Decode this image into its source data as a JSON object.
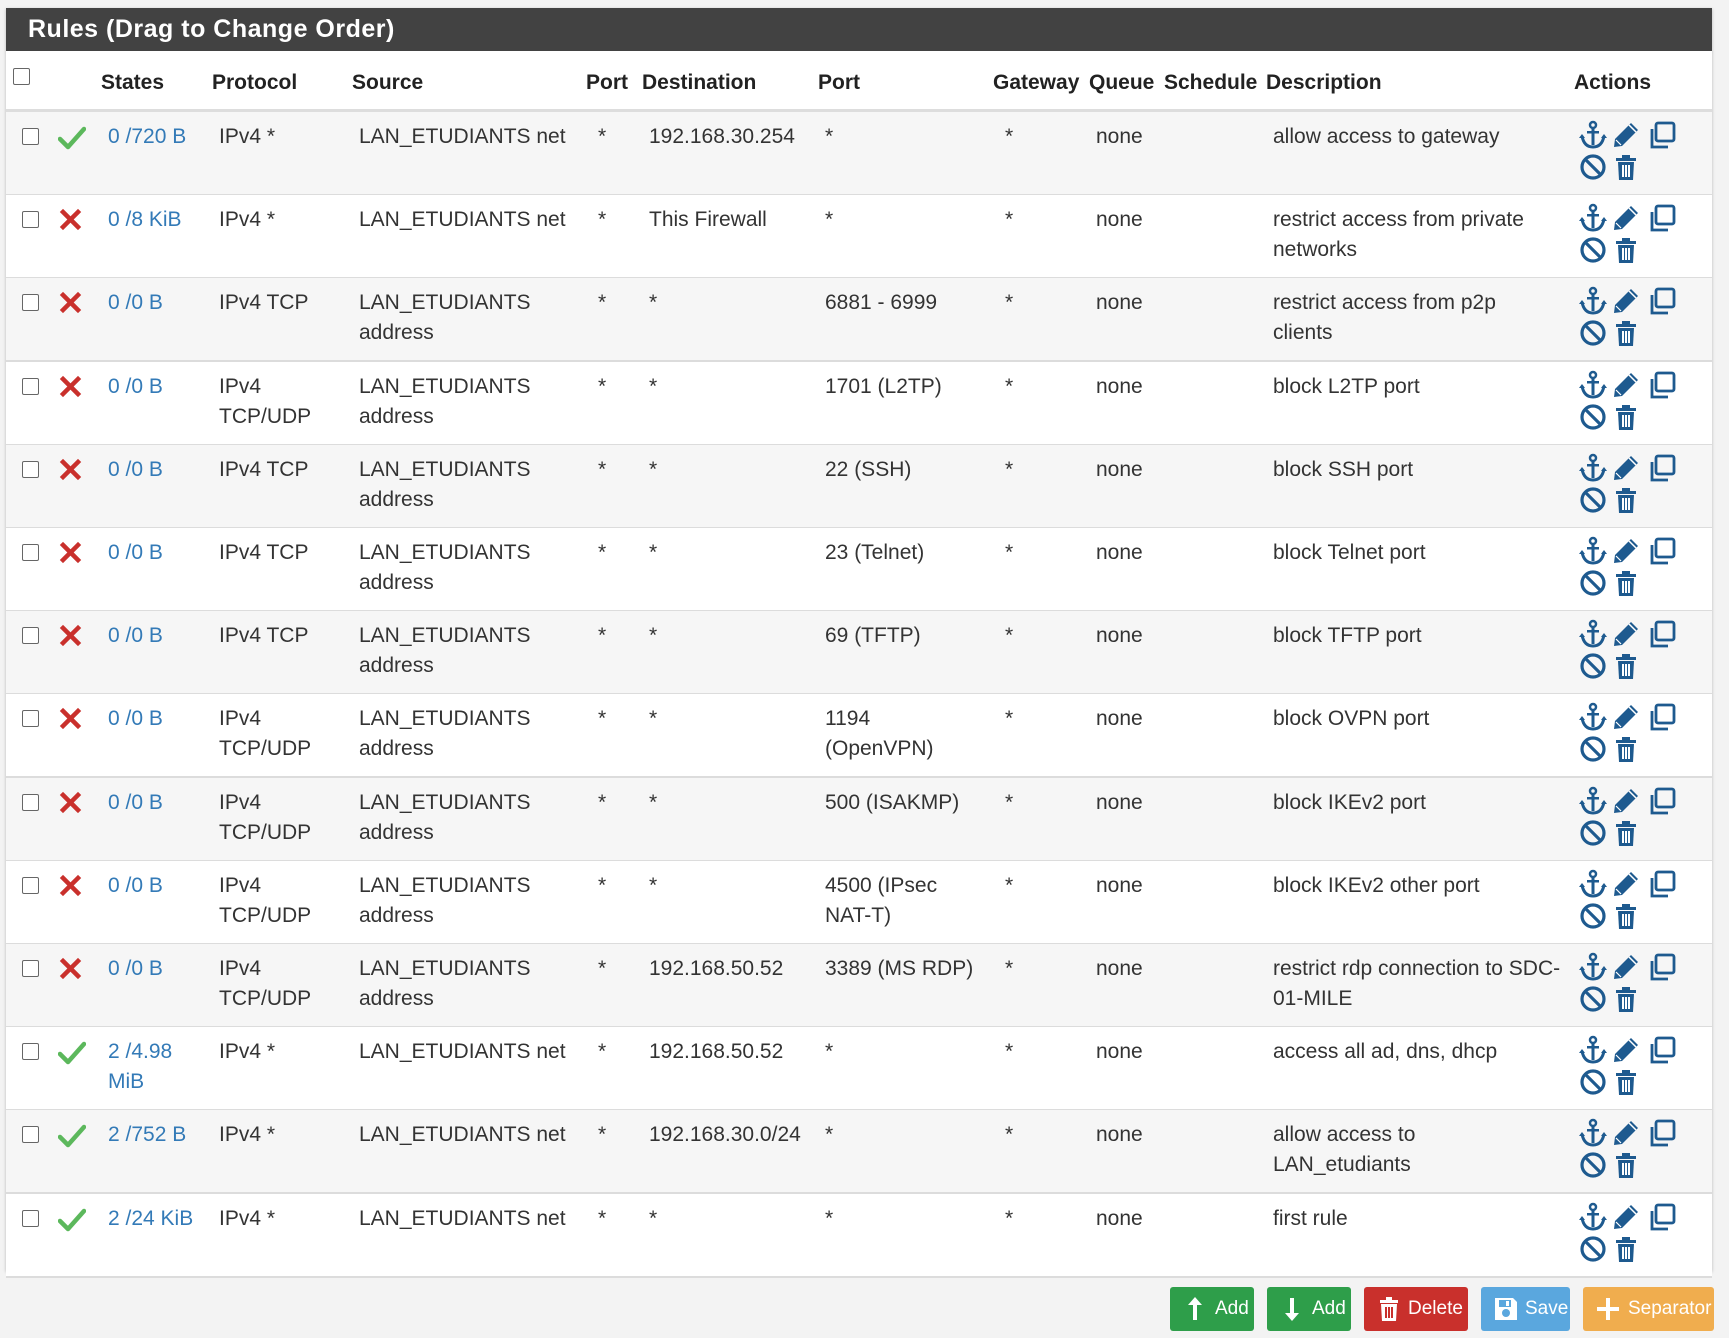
{
  "panel": {
    "title": "Rules (Drag to Change Order)"
  },
  "columns": {
    "states": "States",
    "protocol": "Protocol",
    "source": "Source",
    "port": "Port",
    "destination": "Destination",
    "dest_port": "Port",
    "gateway": "Gateway",
    "queue": "Queue",
    "schedule": "Schedule",
    "description": "Description",
    "actions": "Actions"
  },
  "colors": {
    "pass": "#5cb85c",
    "block": "#c9302c",
    "link": "#337ab7",
    "action_icon": "#1e5a8f",
    "header_bg": "#424242"
  },
  "rules": [
    {
      "status": "pass",
      "states1": "0 /720 B",
      "states2": "",
      "proto1": "IPv4 *",
      "proto2": "",
      "src1": "LAN_ETUDIANTS net",
      "src2": "",
      "sport": "*",
      "dest1": "192.168.30.254",
      "dport1": "*",
      "dport2": "",
      "gateway": "*",
      "queue": "none",
      "schedule": "",
      "desc1": "allow access to gateway",
      "desc2": ""
    },
    {
      "status": "block",
      "states1": "0 /8 KiB",
      "states2": "",
      "proto1": "IPv4 *",
      "proto2": "",
      "src1": "LAN_ETUDIANTS net",
      "src2": "",
      "sport": "*",
      "dest1": "This Firewall",
      "dport1": "*",
      "dport2": "",
      "gateway": "*",
      "queue": "none",
      "schedule": "",
      "desc1": "restrict access from private",
      "desc2": "networks"
    },
    {
      "status": "block",
      "states1": "0 /0 B",
      "states2": "",
      "proto1": "IPv4 TCP",
      "proto2": "",
      "src1": "LAN_ETUDIANTS",
      "src2": "address",
      "sport": "*",
      "dest1": "*",
      "dport1": "6881 - 6999",
      "dport2": "",
      "gateway": "*",
      "queue": "none",
      "schedule": "",
      "desc1": "restrict access from p2p",
      "desc2": "clients"
    },
    {
      "status": "block",
      "states1": "0 /0 B",
      "states2": "",
      "proto1": "IPv4",
      "proto2": "TCP/UDP",
      "src1": "LAN_ETUDIANTS",
      "src2": "address",
      "sport": "*",
      "dest1": "*",
      "dport1": "1701 (L2TP)",
      "dport2": "",
      "gateway": "*",
      "queue": "none",
      "schedule": "",
      "desc1": "block L2TP port",
      "desc2": ""
    },
    {
      "status": "block",
      "states1": "0 /0 B",
      "states2": "",
      "proto1": "IPv4 TCP",
      "proto2": "",
      "src1": "LAN_ETUDIANTS",
      "src2": "address",
      "sport": "*",
      "dest1": "*",
      "dport1": "22 (SSH)",
      "dport2": "",
      "gateway": "*",
      "queue": "none",
      "schedule": "",
      "desc1": "block SSH port",
      "desc2": ""
    },
    {
      "status": "block",
      "states1": "0 /0 B",
      "states2": "",
      "proto1": "IPv4 TCP",
      "proto2": "",
      "src1": "LAN_ETUDIANTS",
      "src2": "address",
      "sport": "*",
      "dest1": "*",
      "dport1": "23 (Telnet)",
      "dport2": "",
      "gateway": "*",
      "queue": "none",
      "schedule": "",
      "desc1": "block Telnet port",
      "desc2": ""
    },
    {
      "status": "block",
      "states1": "0 /0 B",
      "states2": "",
      "proto1": "IPv4 TCP",
      "proto2": "",
      "src1": "LAN_ETUDIANTS",
      "src2": "address",
      "sport": "*",
      "dest1": "*",
      "dport1": "69 (TFTP)",
      "dport2": "",
      "gateway": "*",
      "queue": "none",
      "schedule": "",
      "desc1": "block TFTP port",
      "desc2": ""
    },
    {
      "status": "block",
      "states1": "0 /0 B",
      "states2": "",
      "proto1": "IPv4",
      "proto2": "TCP/UDP",
      "src1": "LAN_ETUDIANTS",
      "src2": "address",
      "sport": "*",
      "dest1": "*",
      "dport1": "1194",
      "dport2": "(OpenVPN)",
      "gateway": "*",
      "queue": "none",
      "schedule": "",
      "desc1": "block OVPN port",
      "desc2": ""
    },
    {
      "status": "block",
      "states1": "0 /0 B",
      "states2": "",
      "proto1": "IPv4",
      "proto2": "TCP/UDP",
      "src1": "LAN_ETUDIANTS",
      "src2": "address",
      "sport": "*",
      "dest1": "*",
      "dport1": "500 (ISAKMP)",
      "dport2": "",
      "gateway": "*",
      "queue": "none",
      "schedule": "",
      "desc1": "block IKEv2 port",
      "desc2": ""
    },
    {
      "status": "block",
      "states1": "0 /0 B",
      "states2": "",
      "proto1": "IPv4",
      "proto2": "TCP/UDP",
      "src1": "LAN_ETUDIANTS",
      "src2": "address",
      "sport": "*",
      "dest1": "*",
      "dport1": "4500 (IPsec",
      "dport2": "NAT-T)",
      "gateway": "*",
      "queue": "none",
      "schedule": "",
      "desc1": "block IKEv2 other port",
      "desc2": ""
    },
    {
      "status": "block",
      "states1": "0 /0 B",
      "states2": "",
      "proto1": "IPv4",
      "proto2": "TCP/UDP",
      "src1": "LAN_ETUDIANTS",
      "src2": "address",
      "sport": "*",
      "dest1": "192.168.50.52",
      "dport1": "3389 (MS RDP)",
      "dport2": "",
      "gateway": "*",
      "queue": "none",
      "schedule": "",
      "desc1": "restrict rdp connection to SDC-",
      "desc2": "01-MILE"
    },
    {
      "status": "pass",
      "states1": "2 /4.98",
      "states2": "MiB",
      "proto1": "IPv4 *",
      "proto2": "",
      "src1": "LAN_ETUDIANTS net",
      "src2": "",
      "sport": "*",
      "dest1": "192.168.50.52",
      "dport1": "*",
      "dport2": "",
      "gateway": "*",
      "queue": "none",
      "schedule": "",
      "desc1": "access all ad, dns, dhcp",
      "desc2": ""
    },
    {
      "status": "pass",
      "states1": "2 /752 B",
      "states2": "",
      "proto1": "IPv4 *",
      "proto2": "",
      "src1": "LAN_ETUDIANTS net",
      "src2": "",
      "sport": "*",
      "dest1": "192.168.30.0/24",
      "dport1": "*",
      "dport2": "",
      "gateway": "*",
      "queue": "none",
      "schedule": "",
      "desc1": "allow access to",
      "desc2": "LAN_etudiants"
    },
    {
      "status": "pass",
      "states1": "2 /24 KiB",
      "states2": "",
      "proto1": "IPv4 *",
      "proto2": "",
      "src1": "LAN_ETUDIANTS net",
      "src2": "",
      "sport": "*",
      "dest1": "*",
      "dport1": "*",
      "dport2": "",
      "gateway": "*",
      "queue": "none",
      "schedule": "",
      "desc1": "first rule",
      "desc2": ""
    }
  ],
  "buttons": {
    "add_top": {
      "label": "Add",
      "color": "#2e9e4a"
    },
    "add_bottom": {
      "label": "Add",
      "color": "#2e9e4a"
    },
    "delete": {
      "label": "Delete",
      "color": "#c9302c"
    },
    "save": {
      "label": "Save",
      "color": "#5aa7de"
    },
    "separator": {
      "label": "Separator",
      "color": "#f0ad4e"
    }
  }
}
